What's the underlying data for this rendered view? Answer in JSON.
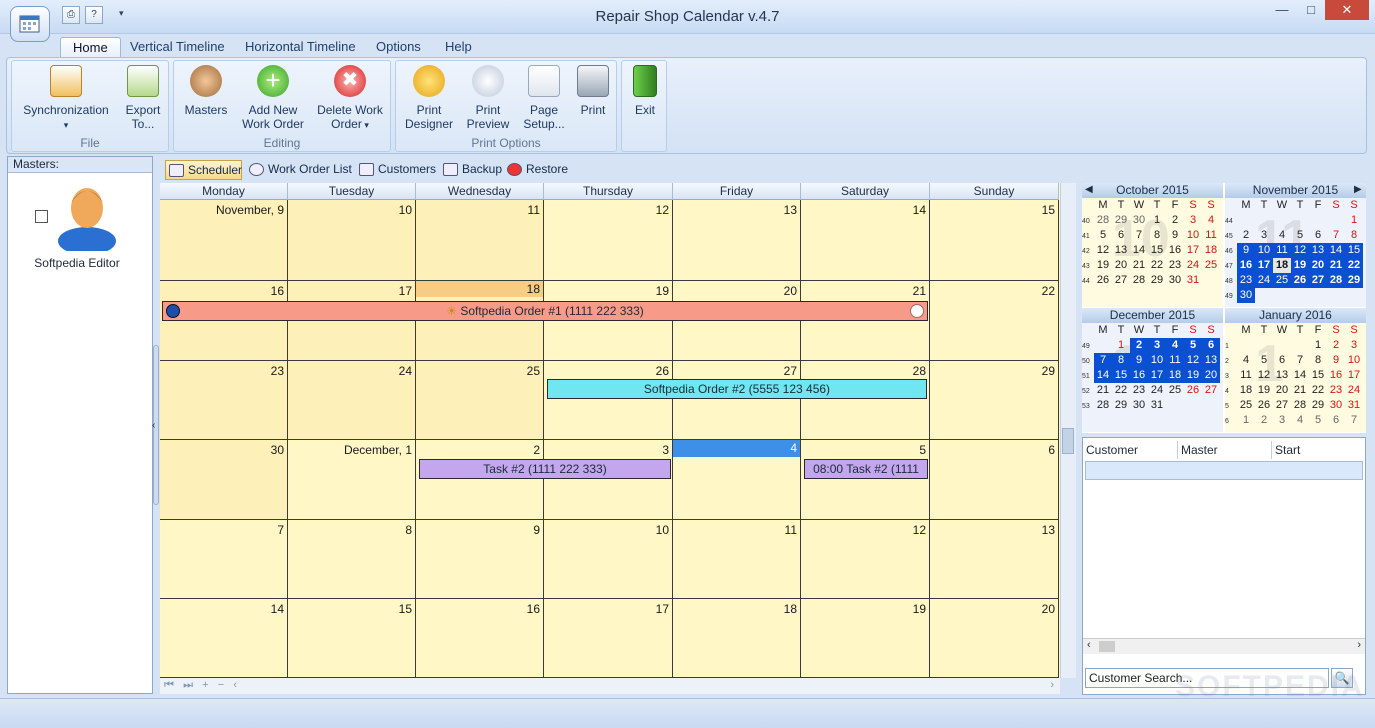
{
  "window": {
    "title": "Repair Shop Calendar v.4.7"
  },
  "quick_access": [
    "print-icon",
    "help-icon",
    "dropdown-icon"
  ],
  "ribbon_tabs": [
    "Home",
    "Vertical Timeline",
    "Horizontal Timeline",
    "Options",
    "Help"
  ],
  "ribbon": {
    "file": {
      "label": "File",
      "sync": "Synchronization",
      "export_line1": "Export",
      "export_line2": "To..."
    },
    "editing": {
      "label": "Editing",
      "masters": "Masters",
      "add_line1": "Add New",
      "add_line2": "Work Order",
      "delete_line1": "Delete Work",
      "delete_line2": "Order"
    },
    "print": {
      "label": "Print Options",
      "designer_line1": "Print",
      "designer_line2": "Designer",
      "preview_line1": "Print",
      "preview_line2": "Preview",
      "setup_line1": "Page",
      "setup_line2": "Setup...",
      "print": "Print"
    },
    "exit": {
      "label": "Exit"
    }
  },
  "masters_panel": {
    "header": "Masters:",
    "master_name": "Softpedia Editor"
  },
  "view_tabs": [
    "Scheduler",
    "Work Order List",
    "Customers",
    "Backup",
    "Restore"
  ],
  "calendar": {
    "days": [
      "Monday",
      "Tuesday",
      "Wednesday",
      "Thursday",
      "Friday",
      "Saturday",
      "Sunday"
    ],
    "weeks": [
      [
        "November, 9",
        "10",
        "11",
        "12",
        "13",
        "14",
        "15"
      ],
      [
        "16",
        "17",
        "18",
        "19",
        "20",
        "21",
        "22"
      ],
      [
        "23",
        "24",
        "25",
        "26",
        "27",
        "28",
        "29"
      ],
      [
        "30",
        "December, 1",
        "2",
        "3",
        "4",
        "5",
        "6"
      ],
      [
        "7",
        "8",
        "9",
        "10",
        "11",
        "12",
        "13"
      ],
      [
        "14",
        "15",
        "16",
        "17",
        "18",
        "19",
        "20"
      ]
    ],
    "events": [
      {
        "label": "Softpedia Order #1 (1111 222 333)",
        "color": "#f79a87"
      },
      {
        "label": "Softpedia Order #2 (5555 123 456)",
        "color": "#6fe6f0"
      },
      {
        "label": "Task #2 (1111 222 333)",
        "color": "#c3a6ee"
      },
      {
        "label": "08:00 Task #2 (1111",
        "color": "#c3a6ee"
      }
    ],
    "today_color": "#3d8fe8"
  },
  "mini_calendars": {
    "dow": [
      "M",
      "T",
      "W",
      "T",
      "F",
      "S",
      "S"
    ],
    "months": [
      {
        "title": "October 2015",
        "big": "10",
        "weeks": [
          "40",
          "41",
          "42",
          "43",
          "44"
        ],
        "rows": [
          [
            "28",
            "29",
            "30",
            "1",
            "2",
            "3",
            "4"
          ],
          [
            "5",
            "6",
            "7",
            "8",
            "9",
            "10",
            "11"
          ],
          [
            "12",
            "13",
            "14",
            "15",
            "16",
            "17",
            "18"
          ],
          [
            "19",
            "20",
            "21",
            "22",
            "23",
            "24",
            "25"
          ],
          [
            "26",
            "27",
            "28",
            "29",
            "30",
            "31",
            ""
          ]
        ]
      },
      {
        "title": "November 2015",
        "big": "11",
        "weeks": [
          "44",
          "45",
          "46",
          "47",
          "48",
          "49"
        ],
        "rows": [
          [
            "",
            "",
            "",
            "",
            "",
            "",
            "1"
          ],
          [
            "2",
            "3",
            "4",
            "5",
            "6",
            "7",
            "8"
          ],
          [
            "9",
            "10",
            "11",
            "12",
            "13",
            "14",
            "15"
          ],
          [
            "16",
            "17",
            "18",
            "19",
            "20",
            "21",
            "22"
          ],
          [
            "23",
            "24",
            "25",
            "26",
            "27",
            "28",
            "29"
          ],
          [
            "30",
            "",
            "",
            "",
            "",
            "",
            ""
          ]
        ]
      },
      {
        "title": "December 2015",
        "big": "12",
        "weeks": [
          "49",
          "50",
          "51",
          "52",
          "53"
        ],
        "rows": [
          [
            "",
            "1",
            "2",
            "3",
            "4",
            "5",
            "6"
          ],
          [
            "7",
            "8",
            "9",
            "10",
            "11",
            "12",
            "13"
          ],
          [
            "14",
            "15",
            "16",
            "17",
            "18",
            "19",
            "20"
          ],
          [
            "21",
            "22",
            "23",
            "24",
            "25",
            "26",
            "27"
          ],
          [
            "28",
            "29",
            "30",
            "31",
            "",
            "",
            ""
          ]
        ]
      },
      {
        "title": "January 2016",
        "big": "1",
        "weeks": [
          "1",
          "2",
          "3",
          "4",
          "5",
          "6"
        ],
        "rows": [
          [
            "",
            "",
            "",
            "",
            "1",
            "2",
            "3"
          ],
          [
            "4",
            "5",
            "6",
            "7",
            "8",
            "9",
            "10"
          ],
          [
            "11",
            "12",
            "13",
            "14",
            "15",
            "16",
            "17"
          ],
          [
            "18",
            "19",
            "20",
            "21",
            "22",
            "23",
            "24"
          ],
          [
            "25",
            "26",
            "27",
            "28",
            "29",
            "30",
            "31"
          ],
          [
            "1",
            "2",
            "3",
            "4",
            "5",
            "6",
            "7"
          ]
        ]
      }
    ]
  },
  "grid": {
    "columns": [
      "Customer",
      "Master",
      "Start"
    ]
  },
  "search": {
    "placeholder": "Customer Search..."
  },
  "watermark": "SOFTPEDIA"
}
